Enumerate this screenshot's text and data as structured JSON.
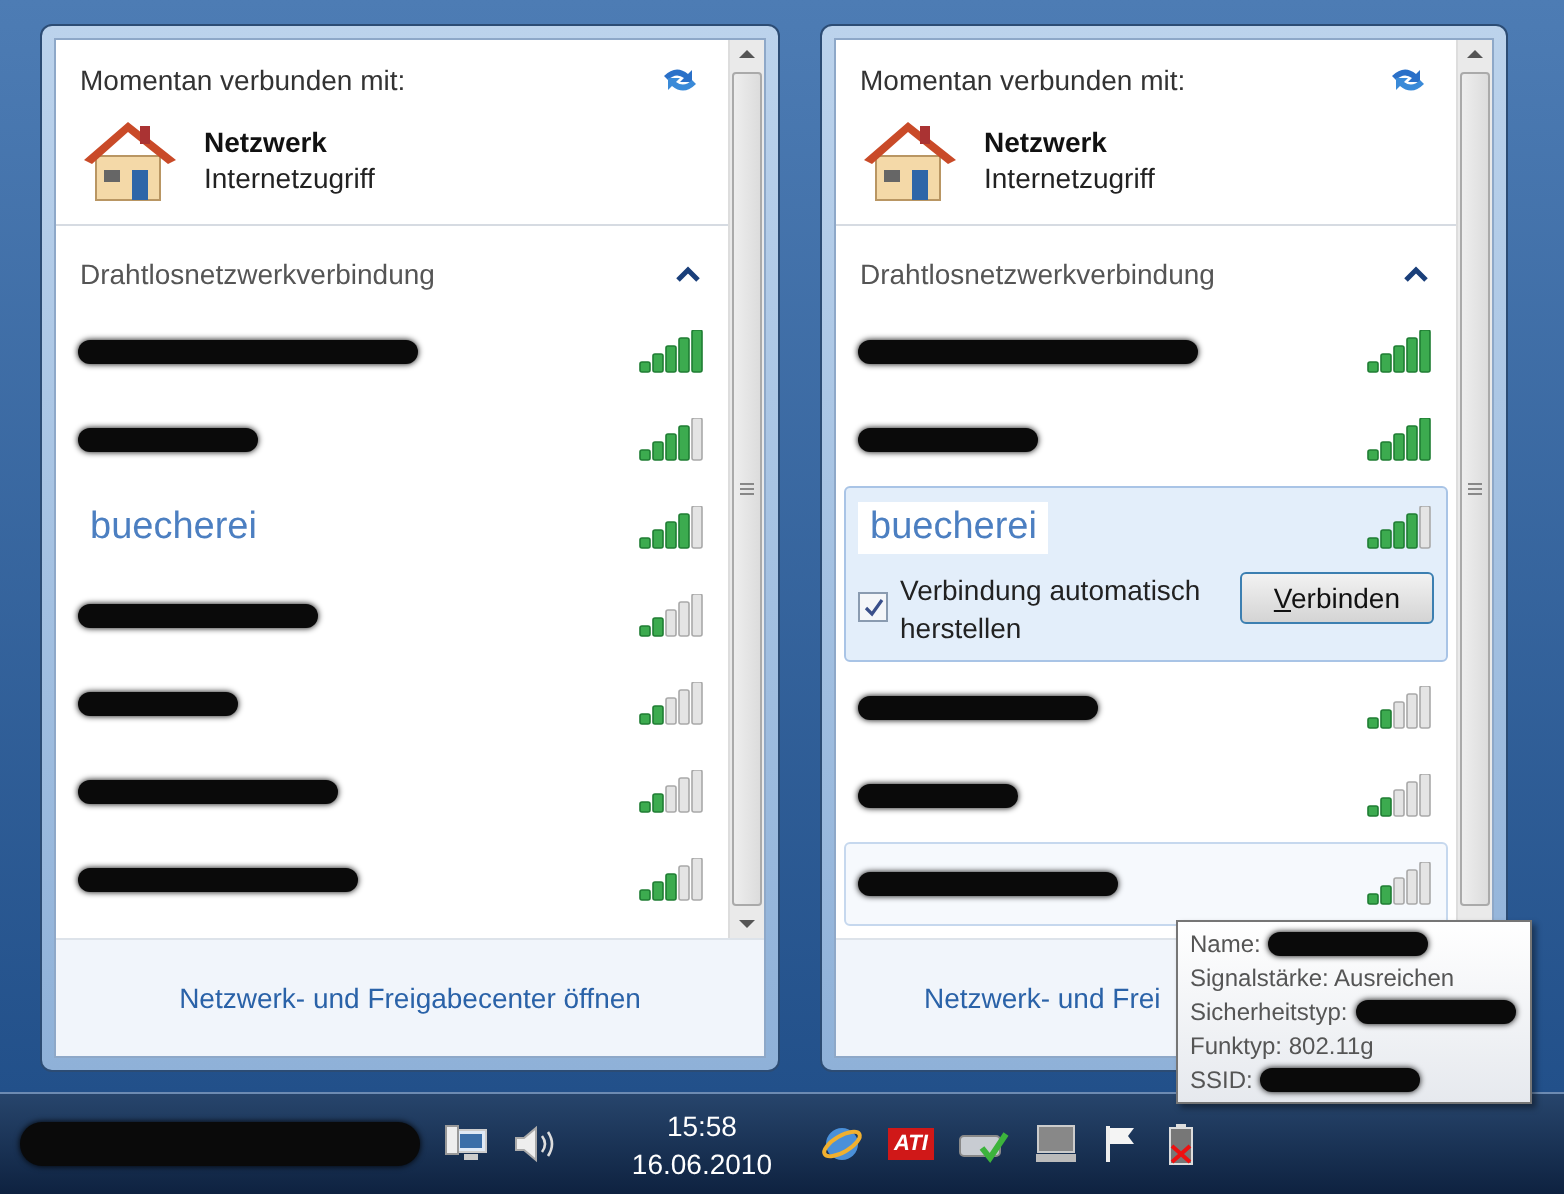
{
  "panels": [
    {
      "connected_label": "Momentan verbunden mit:",
      "network_name": "Netzwerk",
      "network_status": "Internetzugriff",
      "section_title": "Drahtlosnetzwerkverbindung",
      "networks": [
        {
          "redacted": true,
          "level": 1,
          "expanded": false,
          "hovered": false
        },
        {
          "redacted": true,
          "level": 0.8,
          "expanded": false,
          "hovered": false
        },
        {
          "redacted": false,
          "name": "buecherei",
          "level": 0.8,
          "expanded": false,
          "hovered": false
        },
        {
          "redacted": true,
          "level": 0.4,
          "expanded": false,
          "hovered": false
        },
        {
          "redacted": true,
          "level": 0.4,
          "expanded": false,
          "hovered": false
        },
        {
          "redacted": true,
          "level": 0.4,
          "expanded": false,
          "hovered": false
        },
        {
          "redacted": true,
          "level": 0.6,
          "expanded": false,
          "hovered": false
        }
      ],
      "footer_link": "Netzwerk- und Freigabecenter öffnen",
      "taskbar": {
        "items": [
          {
            "kind": "redacted"
          },
          {
            "kind": "network"
          },
          {
            "kind": "volume"
          }
        ],
        "time": "15:58",
        "date": "16.06.2010"
      }
    },
    {
      "connected_label": "Momentan verbunden mit:",
      "network_name": "Netzwerk",
      "network_status": "Internetzugriff",
      "section_title": "Drahtlosnetzwerkverbindung",
      "networks": [
        {
          "redacted": true,
          "level": 1,
          "expanded": false,
          "hovered": false
        },
        {
          "redacted": true,
          "level": 1,
          "expanded": false,
          "hovered": false
        },
        {
          "redacted": false,
          "name": "buecherei",
          "level": 0.8,
          "expanded": true,
          "hovered": false,
          "auto_connect": {
            "label": "Verbindung automatisch herstellen",
            "checked": true
          },
          "button": "Verbinden"
        },
        {
          "redacted": true,
          "level": 0.4,
          "expanded": false,
          "hovered": false
        },
        {
          "redacted": true,
          "level": 0.4,
          "expanded": false,
          "hovered": false
        },
        {
          "redacted": true,
          "level": 0.4,
          "expanded": false,
          "hovered": true
        }
      ],
      "footer_link": "Netzwerk- und Frei",
      "taskbar": {
        "items": [
          {
            "kind": "ie"
          },
          {
            "kind": "ati",
            "label": "ATI"
          },
          {
            "kind": "check"
          },
          {
            "kind": "drive"
          },
          {
            "kind": "flag"
          },
          {
            "kind": "battery"
          }
        ]
      },
      "tooltip": {
        "lines": [
          {
            "text": "Name:",
            "redacted": true
          },
          {
            "text": "Signalstärke: Ausreichen",
            "redacted": false
          },
          {
            "text": "Sicherheitstyp:",
            "redacted": true
          },
          {
            "text": "Funktyp: 802.11g",
            "redacted": false
          },
          {
            "text": "SSID:",
            "redacted": true
          }
        ]
      }
    }
  ]
}
